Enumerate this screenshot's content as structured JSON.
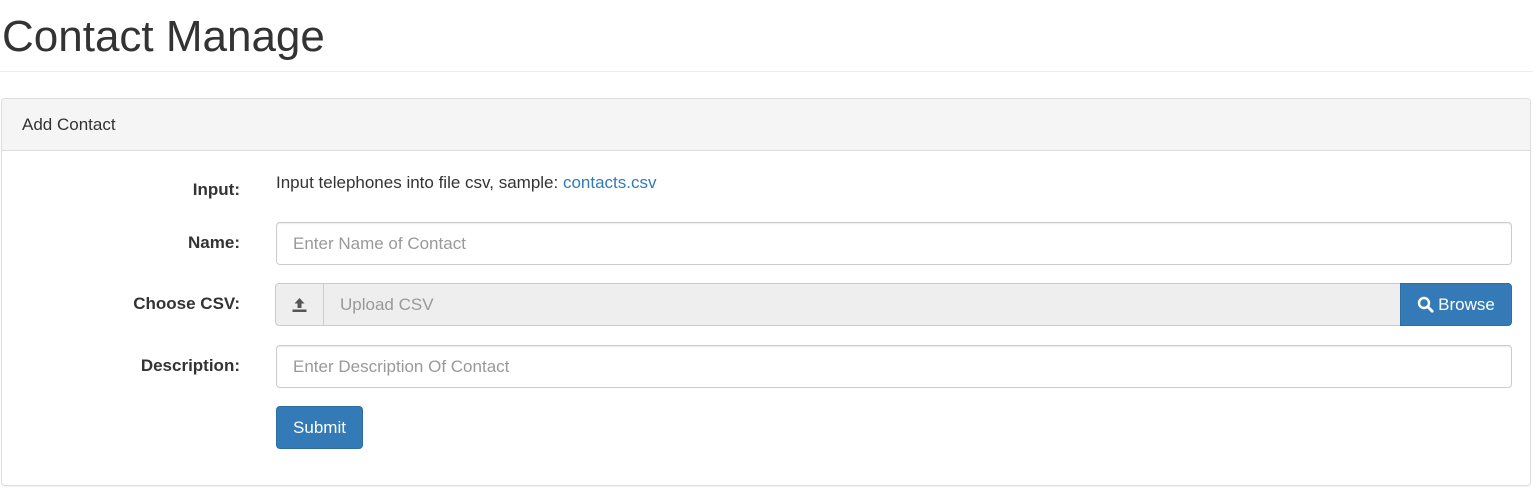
{
  "page": {
    "title": "Contact Manage"
  },
  "panel": {
    "heading": "Add Contact"
  },
  "form": {
    "input_label": "Input:",
    "input_text": "Input telephones into file csv, sample: ",
    "input_link": "contacts.csv",
    "name_label": "Name:",
    "name_placeholder": "Enter Name of Contact",
    "csv_label": "Choose CSV:",
    "csv_placeholder": "Upload CSV",
    "browse_label": "Browse",
    "description_label": "Description:",
    "description_placeholder": "Enter Description Of Contact",
    "submit_label": "Submit"
  },
  "icons": {
    "upload": "upload-icon",
    "search": "search-icon"
  },
  "colors": {
    "primary": "#337ab7",
    "link": "#337ab7",
    "panel_heading_bg": "#f5f5f5",
    "addon_bg": "#eeeeee"
  }
}
